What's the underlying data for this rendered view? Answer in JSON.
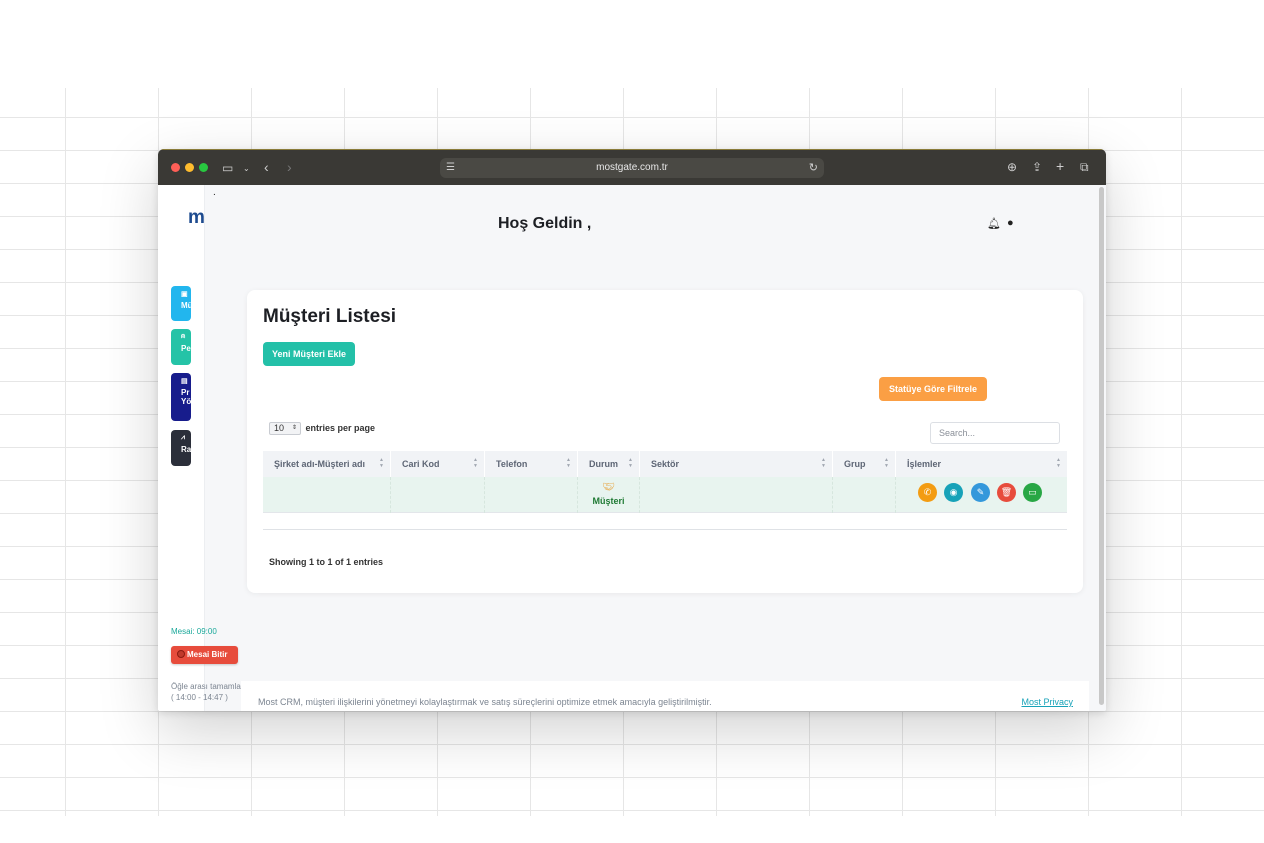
{
  "browser": {
    "url": "mostgate.com.tr"
  },
  "sidebar": {
    "logo": "m",
    "items": [
      {
        "label": "Mü",
        "icon": "users-icon",
        "color": "#22b6ee"
      },
      {
        "label": "Pe",
        "icon": "person-icon",
        "color": "#25c3a7"
      },
      {
        "label": "Pr Yö",
        "icon": "project-icon",
        "color": "#171c8c"
      },
      {
        "label": "Ra",
        "icon": "chart-icon",
        "color": "#2b2f3a"
      }
    ],
    "shift_label": "Mesai: 09:00",
    "shift_button": "Mesai Bitir",
    "lunch_line1": "Öğle arası tamamlandı",
    "lunch_line2": "( 14:00 - 14:47 )"
  },
  "header": {
    "welcome": "Hoş Geldin ,"
  },
  "card": {
    "title": "Müşteri Listesi",
    "new_button": "Yeni Müşteri Ekle",
    "filter_button": "Statüye Göre Filtrele",
    "entries_value": "10",
    "entries_label": "entries per page",
    "search_placeholder": "Search...",
    "columns": [
      "Şirket adı-Müşteri adı",
      "Cari Kod",
      "Telefon",
      "Durum",
      "Sektör",
      "Grup",
      "İşlemler"
    ],
    "rows": [
      {
        "company": "",
        "code": "",
        "phone": "",
        "status": "Müşteri",
        "status_icon": "handshake-icon",
        "sector": "",
        "group": ""
      }
    ],
    "showing": "Showing 1 to 1 of 1 entries"
  },
  "footer": {
    "text": "Most CRM, müşteri ilişkilerini yönetmeyi kolaylaştırmak ve satış süreçlerini optimize etmek amacıyla geliştirilmiştir.",
    "link": "Most Privacy"
  }
}
